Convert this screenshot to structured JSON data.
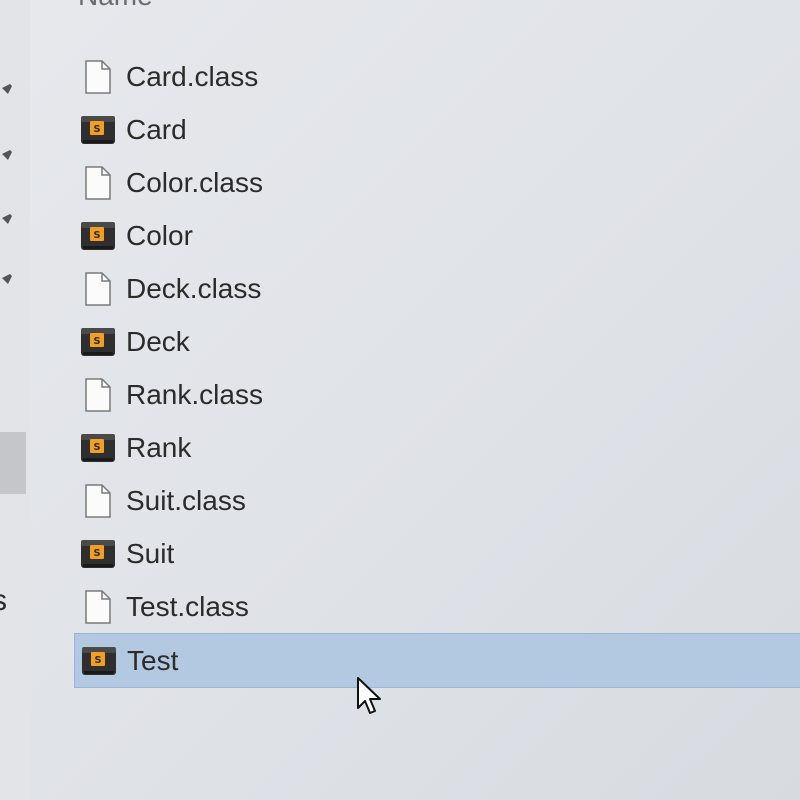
{
  "file_list": {
    "column_header": "Name",
    "items": [
      {
        "name": "Card.class",
        "icon": "class-file-icon"
      },
      {
        "name": "Card",
        "icon": "sublime-file-icon"
      },
      {
        "name": "Color.class",
        "icon": "class-file-icon"
      },
      {
        "name": "Color",
        "icon": "sublime-file-icon"
      },
      {
        "name": "Deck.class",
        "icon": "class-file-icon"
      },
      {
        "name": "Deck",
        "icon": "sublime-file-icon"
      },
      {
        "name": "Rank.class",
        "icon": "class-file-icon"
      },
      {
        "name": "Rank",
        "icon": "sublime-file-icon"
      },
      {
        "name": "Suit.class",
        "icon": "class-file-icon"
      },
      {
        "name": "Suit",
        "icon": "sublime-file-icon"
      },
      {
        "name": "Test.class",
        "icon": "class-file-icon"
      },
      {
        "name": "Test",
        "icon": "sublime-file-icon",
        "selected": true
      }
    ]
  },
  "nav_pane": {
    "partial_label": "s"
  },
  "colors": {
    "selection": "#b3c9e1",
    "background": "#e3e6ea"
  }
}
